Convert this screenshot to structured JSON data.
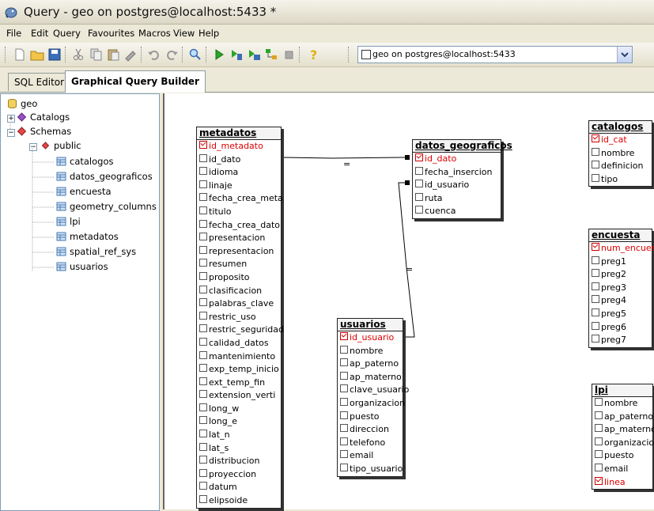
{
  "window": {
    "title": "Query - geo on postgres@localhost:5433 *"
  },
  "menu": [
    "File",
    "Edit",
    "Query",
    "Favourites",
    "Macros",
    "View",
    "Help"
  ],
  "toolbar": {
    "icons": [
      "new-file-icon",
      "open-folder-icon",
      "save-icon",
      "cut-icon",
      "copy-icon",
      "paste-icon",
      "clear-icon",
      "undo-icon",
      "redo-icon",
      "find-icon",
      "execute-icon",
      "explain-icon",
      "execute-to-file-icon",
      "explain-analyze-icon",
      "stop-icon",
      "help-icon"
    ],
    "connection": "geo on postgres@localhost:5433"
  },
  "tabs": [
    {
      "label": "SQL Editor"
    },
    {
      "label": "Graphical Query Builder"
    }
  ],
  "tree": {
    "root": "geo",
    "catalogs": "Catalogs",
    "schemas": "Schemas",
    "schema": "public",
    "tables": [
      "catalogos",
      "datos_geograficos",
      "encuesta",
      "geometry_columns",
      "lpi",
      "metadatos",
      "spatial_ref_sys",
      "usuarios"
    ]
  },
  "diagram": {
    "tables": {
      "metadatos": {
        "name": "metadatos",
        "fields": [
          "id_metadato",
          "id_dato",
          "idioma",
          "linaje",
          "fecha_crea_meta",
          "titulo",
          "fecha_crea_dato",
          "presentacion",
          "representacion",
          "resumen",
          "proposito",
          "clasificacion",
          "palabras_clave",
          "restric_uso",
          "restric_seguridad",
          "calidad_datos",
          "mantenimiento",
          "exp_temp_inicio",
          "ext_temp_fin",
          "extension_verti",
          "long_w",
          "long_e",
          "lat_n",
          "lat_s",
          "distribucion",
          "proyeccion",
          "datum",
          "elipsoide"
        ],
        "checked": [
          "id_metadato"
        ]
      },
      "datos_geograficos": {
        "name": "datos_geograficos",
        "fields": [
          "id_dato",
          "fecha_insercion",
          "id_usuario",
          "ruta",
          "cuenca"
        ],
        "checked": [
          "id_dato"
        ]
      },
      "catalogos": {
        "name": "catalogos",
        "fields": [
          "id_cat",
          "nombre",
          "definicion",
          "tipo"
        ],
        "checked": [
          "id_cat"
        ]
      },
      "encuesta": {
        "name": "encuesta",
        "fields": [
          "num_encuesta",
          "preg1",
          "preg2",
          "preg3",
          "preg4",
          "preg5",
          "preg6",
          "preg7"
        ],
        "checked": [
          "num_encuesta"
        ]
      },
      "usuarios": {
        "name": "usuarios",
        "fields": [
          "id_usuario",
          "nombre",
          "ap_paterno",
          "ap_materno",
          "clave_usuario",
          "organizacion",
          "puesto",
          "direccion",
          "telefono",
          "email",
          "tipo_usuario"
        ],
        "checked": [
          "id_usuario"
        ]
      },
      "lpi": {
        "name": "lpi",
        "fields": [
          "nombre",
          "ap_paterno",
          "ap_materno",
          "organizacion",
          "puesto",
          "email",
          "linea"
        ],
        "checked": [
          "linea"
        ]
      }
    },
    "joins": [
      {
        "from": "metadatos.id_dato",
        "to": "datos_geograficos.id_dato",
        "op": "="
      },
      {
        "from": "datos_geograficos.id_usuario",
        "to": "usuarios.id_usuario",
        "op": "="
      }
    ]
  }
}
